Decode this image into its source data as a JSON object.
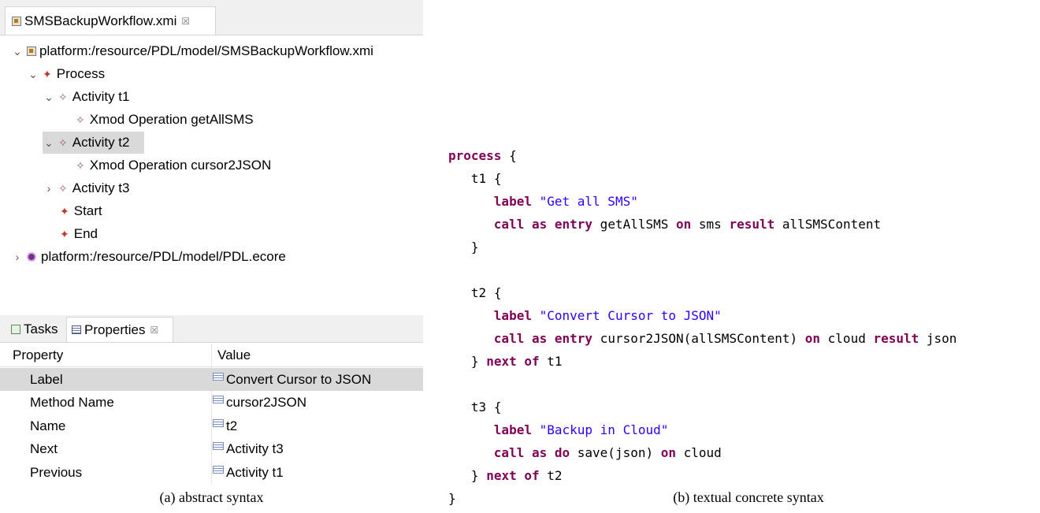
{
  "editor": {
    "tab_title": "SMSBackupWorkflow.xmi",
    "tab_close": "☒"
  },
  "tree": {
    "resource_xmi": "platform:/resource/PDL/model/SMSBackupWorkflow.xmi",
    "process": "Process",
    "activity_t1": "Activity t1",
    "op_getAllSMS": "Xmod Operation getAllSMS",
    "activity_t2": "Activity t2",
    "op_cursor2JSON": "Xmod Operation cursor2JSON",
    "activity_t3": "Activity t3",
    "start": "Start",
    "end": "End",
    "resource_ecore": "platform:/resource/PDL/model/PDL.ecore"
  },
  "views": {
    "tasks_label": "Tasks",
    "properties_label": "Properties",
    "properties_close": "☒"
  },
  "properties": {
    "header_property": "Property",
    "header_value": "Value",
    "rows": [
      {
        "property": "Label",
        "value": "Convert Cursor to JSON"
      },
      {
        "property": "Method Name",
        "value": "cursor2JSON"
      },
      {
        "property": "Name",
        "value": "t2"
      },
      {
        "property": "Next",
        "value": "Activity t3"
      },
      {
        "property": "Previous",
        "value": "Activity t1"
      }
    ]
  },
  "captions": {
    "a": "(a) abstract syntax",
    "b": "(b) textual concrete syntax"
  },
  "code": {
    "kw_process": "process",
    "open": "{",
    "t1": "t1",
    "t1_label_str": "\"Get all SMS\"",
    "t1_call_text": " getAllSMS ",
    "t1_on_text": " sms ",
    "t1_result_text": " allSMSContent",
    "t2": "t2",
    "t2_label_str": "\"Convert Cursor to JSON\"",
    "t2_call_text": " cursor2JSON(allSMSContent) ",
    "t2_on_text": " cloud ",
    "t2_result_text": " json",
    "t3": "t3",
    "t3_label_str": "\"Backup in Cloud\"",
    "t3_call_text": " save(json) ",
    "t3_on_text": " cloud",
    "kw_label": "label",
    "kw_call": "call",
    "kw_as": "as",
    "kw_entry": "entry",
    "kw_do": "do",
    "kw_on": "on",
    "kw_result": "result",
    "kw_next": "next",
    "kw_of": "of",
    "close": "}",
    "next_t1": " t1",
    "next_t2": " t2"
  }
}
